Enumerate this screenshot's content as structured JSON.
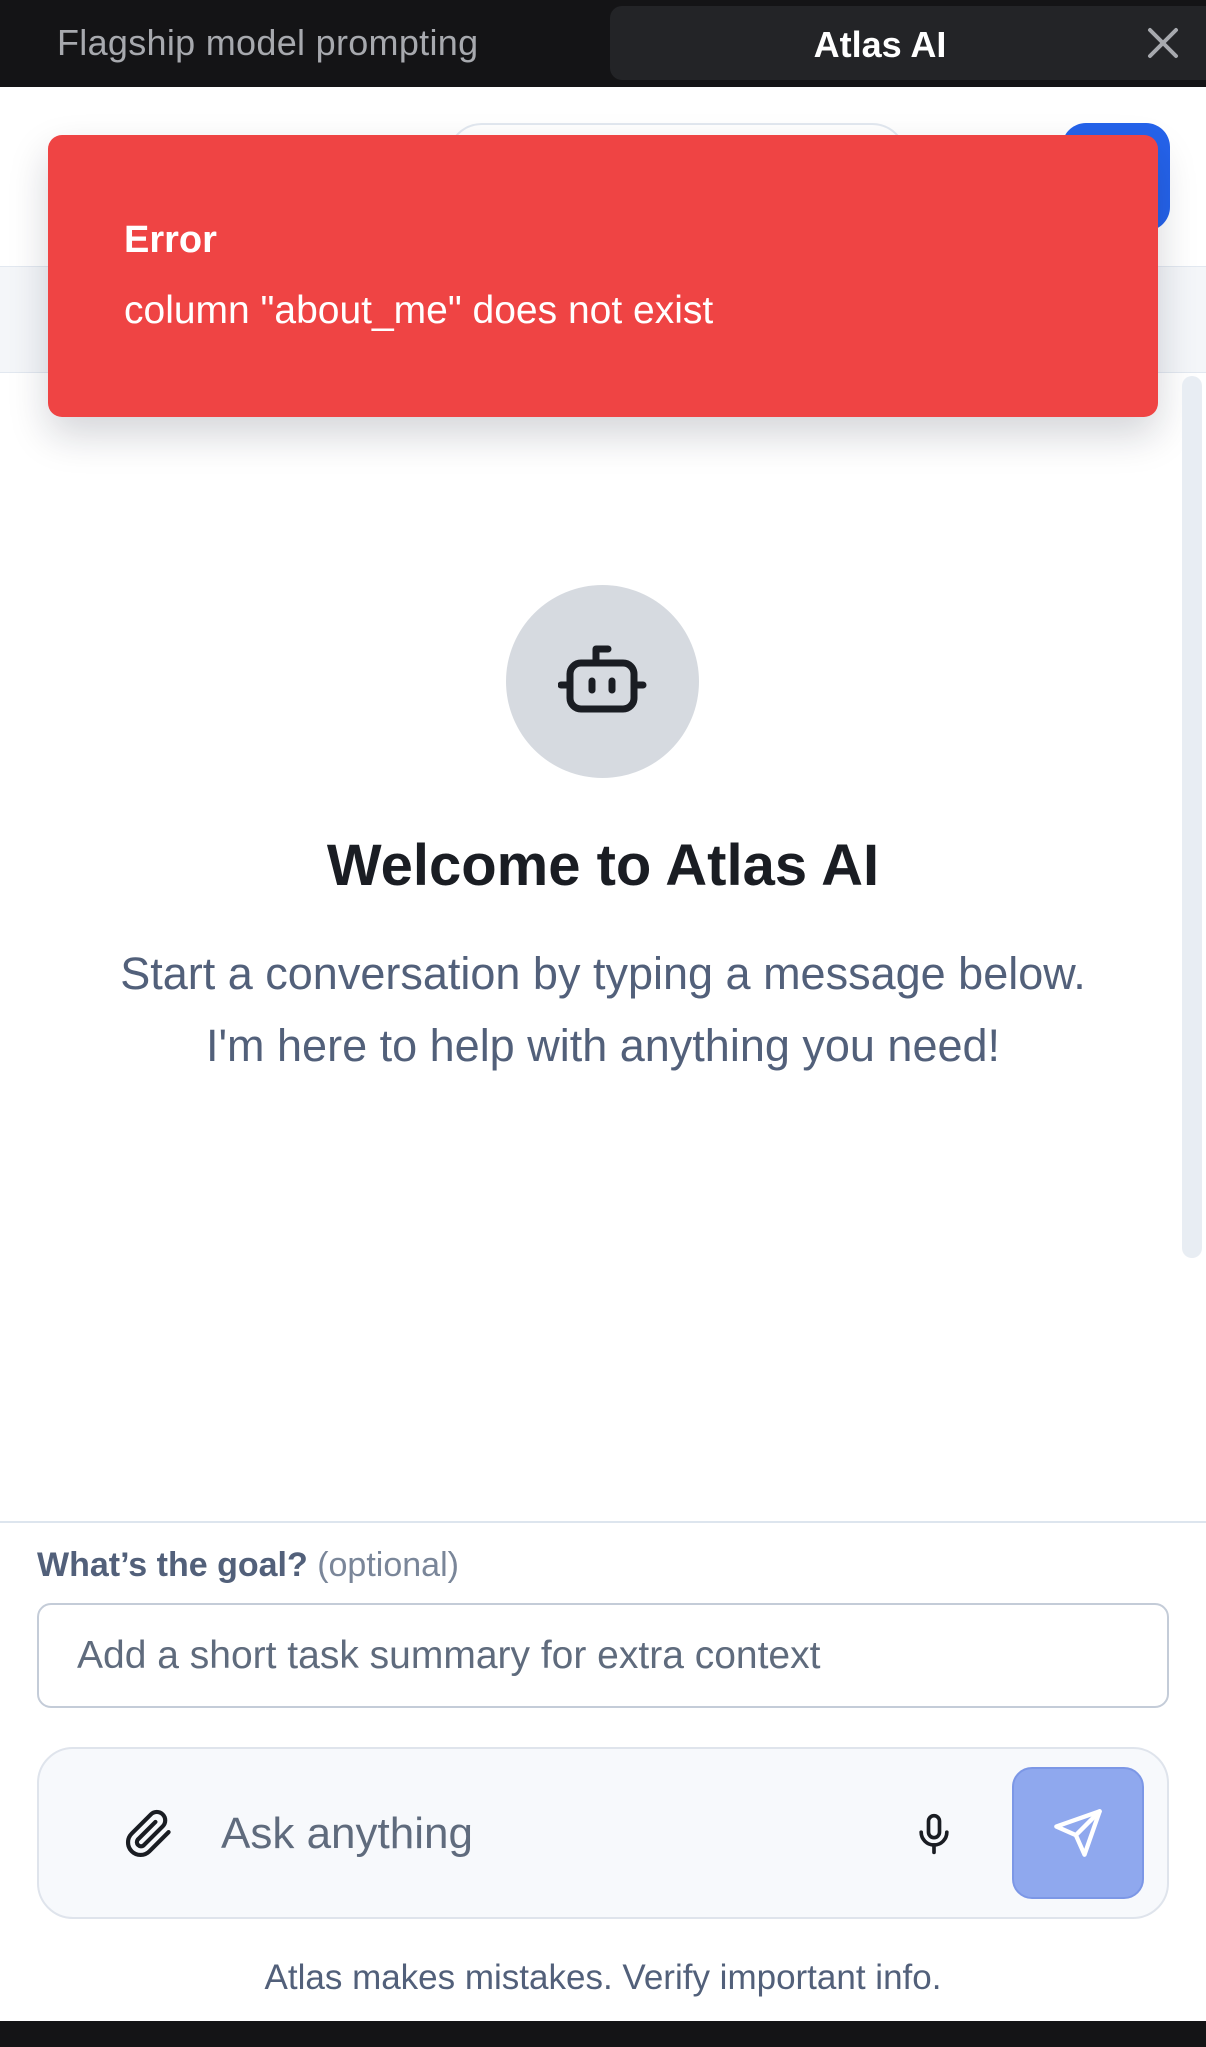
{
  "tabs": {
    "inactive_label": "Flagship model prompting",
    "active_label": "Atlas AI",
    "close_icon": "close-icon"
  },
  "toast": {
    "title": "Error",
    "message": "column \"about_me\" does not exist",
    "color": "#ef4444"
  },
  "welcome": {
    "icon": "bot-icon",
    "title": "Welcome to Atlas AI",
    "subtitle_line1": "Start a conversation by typing a message below.",
    "subtitle_line2": "I'm here to help with anything you need!"
  },
  "goal": {
    "label": "What’s the goal?",
    "optional": "(optional)",
    "placeholder": "Add a short task summary for extra context",
    "value": ""
  },
  "composer": {
    "placeholder": "Ask anything",
    "value": "",
    "attach_icon": "paperclip-icon",
    "mic_icon": "microphone-icon",
    "send_icon": "send-icon",
    "send_color": "#8fa8ee"
  },
  "disclaimer": "Atlas makes mistakes. Verify important info.",
  "colors": {
    "accent": "#2563eb",
    "error": "#ef4444",
    "tab_bar": "#141416"
  }
}
